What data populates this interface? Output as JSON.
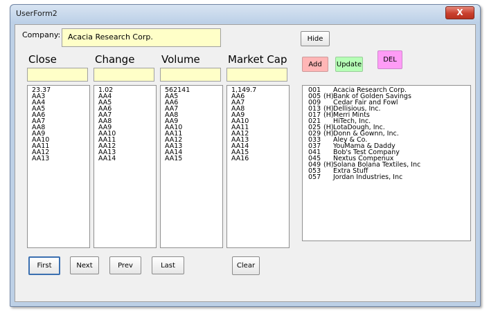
{
  "window": {
    "title": "UserForm2",
    "close_label": "X"
  },
  "company": {
    "label": "Company:",
    "value": "Acacia Research Corp."
  },
  "columns": [
    {
      "header": "Close",
      "input_value": "",
      "items": [
        "23.37",
        "AA3",
        "AA4",
        "AA5",
        "AA6",
        "AA7",
        "AA8",
        "AA9",
        "AA10",
        "AA11",
        "AA12",
        "AA13"
      ]
    },
    {
      "header": "Change",
      "input_value": "",
      "items": [
        "1.02",
        "AA4",
        "AA5",
        "AA6",
        "AA7",
        "AA8",
        "AA9",
        "AA10",
        "AA11",
        "AA12",
        "AA13",
        "AA14"
      ]
    },
    {
      "header": "Volume",
      "input_value": "",
      "items": [
        "562141",
        "AA5",
        "AA6",
        "AA7",
        "AA8",
        "AA9",
        "AA10",
        "AA11",
        "AA12",
        "AA13",
        "AA14",
        "AA15"
      ]
    },
    {
      "header": "Market Cap",
      "input_value": "",
      "items": [
        "1,149.7",
        "AA6",
        "AA7",
        "AA8",
        "AA9",
        "AA10",
        "AA11",
        "AA12",
        "AA13",
        "AA14",
        "AA15",
        "AA16"
      ]
    }
  ],
  "buttons": {
    "hide": "Hide",
    "add": "Add",
    "update": "Update",
    "del": "DEL",
    "first": "First",
    "next": "Next",
    "prev": "Prev",
    "last": "Last",
    "clear": "Clear"
  },
  "colors": {
    "add_bg": "#ffb6b6",
    "update_bg": "#b6ffb6",
    "del_bg": "#ff9cf6",
    "input_bg": "#ffffc8"
  },
  "companies": [
    {
      "code": "001",
      "mark": "",
      "name": "Acacia Research Corp."
    },
    {
      "code": "005",
      "mark": "(H)",
      "name": "Bank of Golden Savings"
    },
    {
      "code": "009",
      "mark": "",
      "name": "Cedar Fair and Fowl"
    },
    {
      "code": "013",
      "mark": "(H)",
      "name": "Dellisious, Inc."
    },
    {
      "code": "017",
      "mark": "(H)",
      "name": "Merri Mints"
    },
    {
      "code": "021",
      "mark": "",
      "name": "HiTech, Inc."
    },
    {
      "code": "025",
      "mark": "(H)",
      "name": "LotaDough, Inc."
    },
    {
      "code": "029",
      "mark": "(H)",
      "name": "Donn & Gownn, Inc."
    },
    {
      "code": "033",
      "mark": "",
      "name": "Aley & Co."
    },
    {
      "code": "037",
      "mark": "",
      "name": "YouMama & Daddy"
    },
    {
      "code": "041",
      "mark": "",
      "name": "Bob's Test Company"
    },
    {
      "code": "045",
      "mark": "",
      "name": "Nextus Compenux"
    },
    {
      "code": "049",
      "mark": "(H)",
      "name": "Solana Bolana Textiles, Inc"
    },
    {
      "code": "053",
      "mark": "",
      "name": "Extra Stuff"
    },
    {
      "code": "057",
      "mark": "",
      "name": "Jordan Industries, Inc"
    }
  ]
}
